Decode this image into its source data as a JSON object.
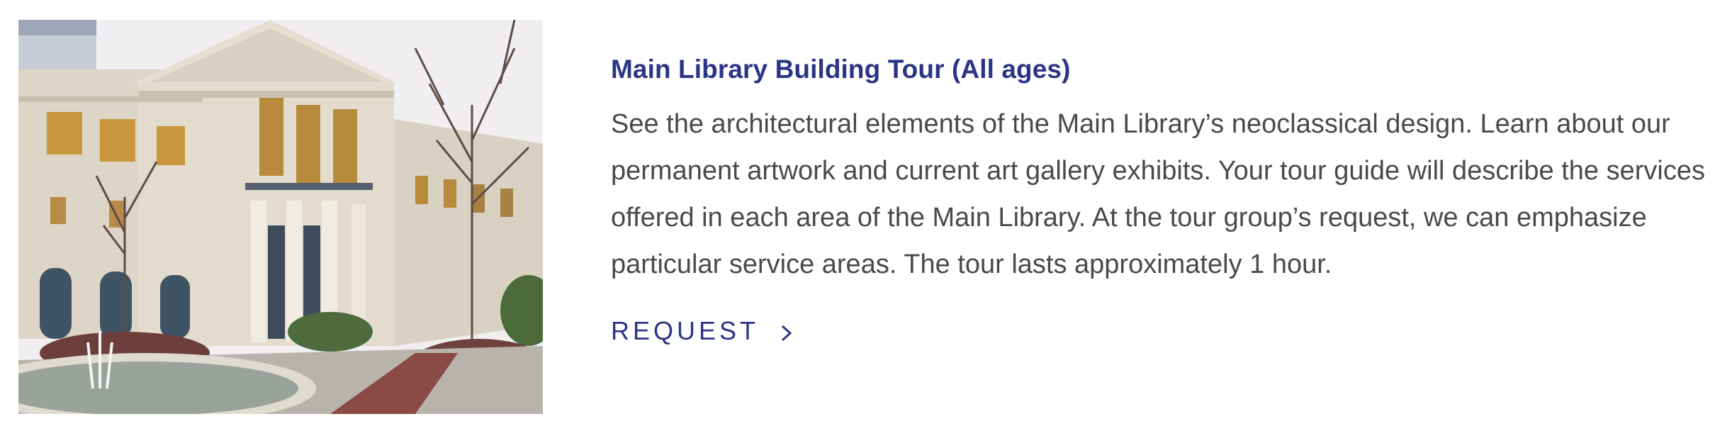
{
  "program": {
    "title": "Main Library Building Tour (All ages)",
    "description": "See the architectural elements of the Main Library’s neoclassical design. Learn about our permanent artwork and current art gallery exhibits. Your tour guide will describe the services offered in each area of the Main Library. At the tour group’s request, we can emphasize particular service areas. The tour lasts approximately 1 hour.",
    "request_label": "REQUEST",
    "request_icon": "chevron-right-icon"
  },
  "colors": {
    "title": "#2b3586",
    "body_text": "#4a4a4a",
    "link": "#2b3586",
    "background": "#ffffff"
  }
}
